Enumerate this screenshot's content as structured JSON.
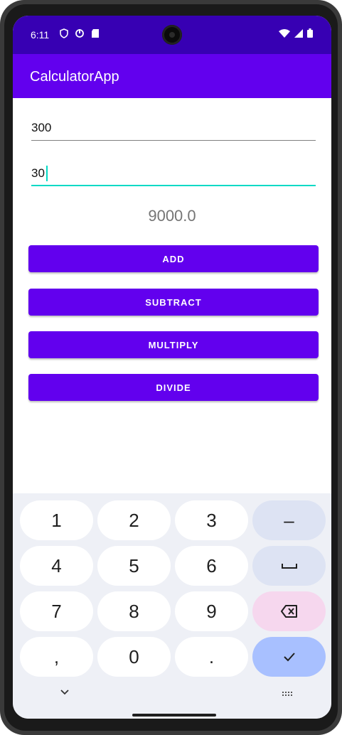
{
  "statusbar": {
    "time": "6:11",
    "left_icons": [
      "shield-icon",
      "sync-icon",
      "sd-card-icon"
    ],
    "right_icons": [
      "wifi-icon",
      "signal-icon",
      "battery-icon"
    ]
  },
  "appbar": {
    "title": "CalculatorApp"
  },
  "inputs": {
    "first_value": "300",
    "second_value": "30"
  },
  "result": "9000.0",
  "buttons": {
    "add": "ADD",
    "subtract": "SUBTRACT",
    "multiply": "MULTIPLY",
    "divide": "DIVIDE"
  },
  "keyboard": {
    "row1": [
      "1",
      "2",
      "3",
      "–"
    ],
    "row2": [
      "4",
      "5",
      "6",
      "space-icon"
    ],
    "row3": [
      "7",
      "8",
      "9",
      "backspace-icon"
    ],
    "row4": [
      ",",
      "0",
      ".",
      "check-icon"
    ]
  },
  "colors": {
    "primary": "#6200ee",
    "primary_dark": "#3700b3",
    "accent": "#03dac5"
  }
}
